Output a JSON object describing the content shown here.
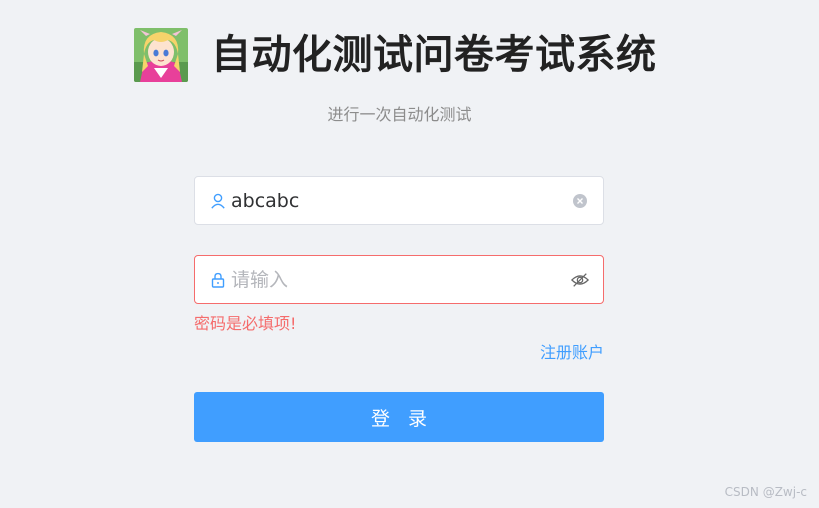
{
  "header": {
    "title": "自动化测试问卷考试系统",
    "subtitle": "进行一次自动化测试"
  },
  "username": {
    "value": "abcabc",
    "prefix_icon": "user-icon",
    "suffix_icon": "clear-circle-icon"
  },
  "password": {
    "placeholder": "请输入",
    "prefix_icon": "lock-icon",
    "suffix_icon": "eye-off-icon",
    "error": "密码是必填项!"
  },
  "register_link": "注册账户",
  "login_button": "登 录",
  "watermark": "CSDN @Zwj-c",
  "colors": {
    "primary": "#409eff",
    "error": "#f56c6c",
    "background": "#f0f2f5"
  }
}
